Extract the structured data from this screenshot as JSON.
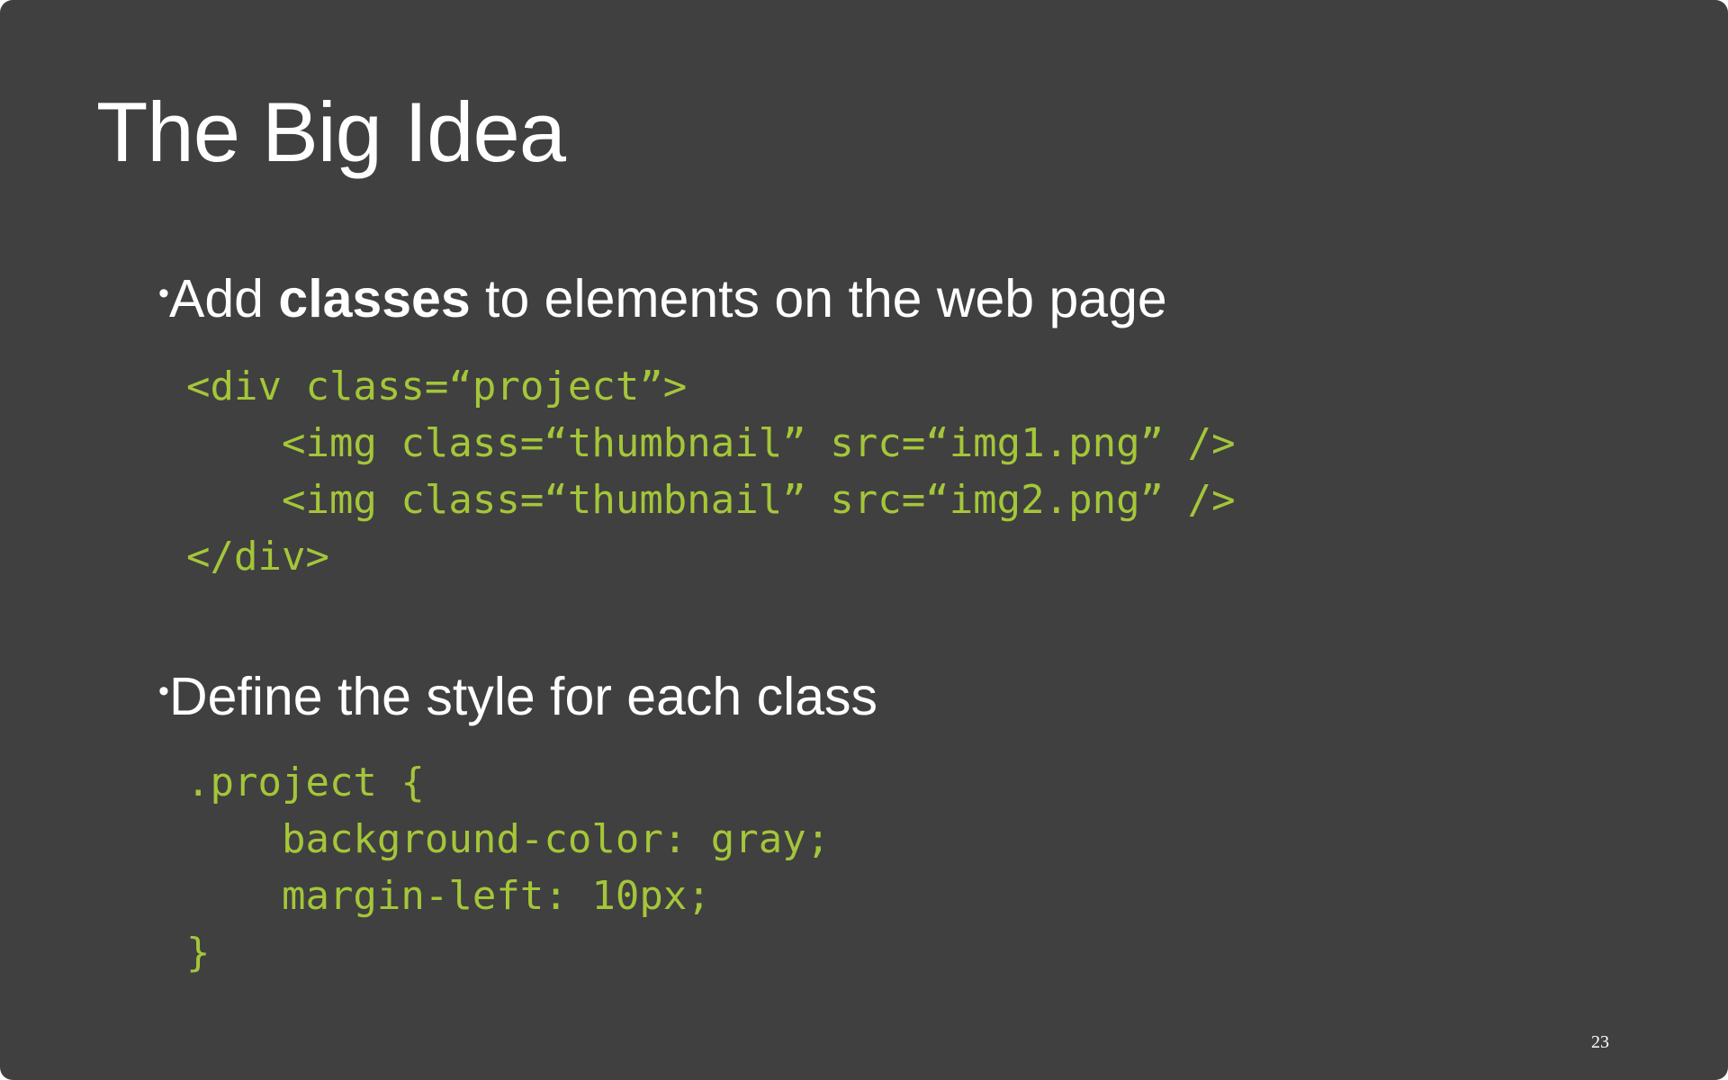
{
  "slide": {
    "title": "The Big Idea",
    "page_number": "23",
    "bullets": [
      {
        "prefix": "Add ",
        "emphasis": "classes",
        "suffix": " to elements on the web page",
        "code_lines": [
          "<div class=“project”>",
          "    <img class=“thumbnail” src=“img1.png” />",
          "    <img class=“thumbnail” src=“img2.png” />",
          "</div>"
        ]
      },
      {
        "text": "Define the style for each class",
        "code_lines": [
          ".project {",
          "    background-color: gray;",
          "    margin-left: 10px;",
          "}"
        ]
      }
    ],
    "colors": {
      "background": "#404040",
      "text": "#ffffff",
      "code": "#a4c639"
    }
  }
}
